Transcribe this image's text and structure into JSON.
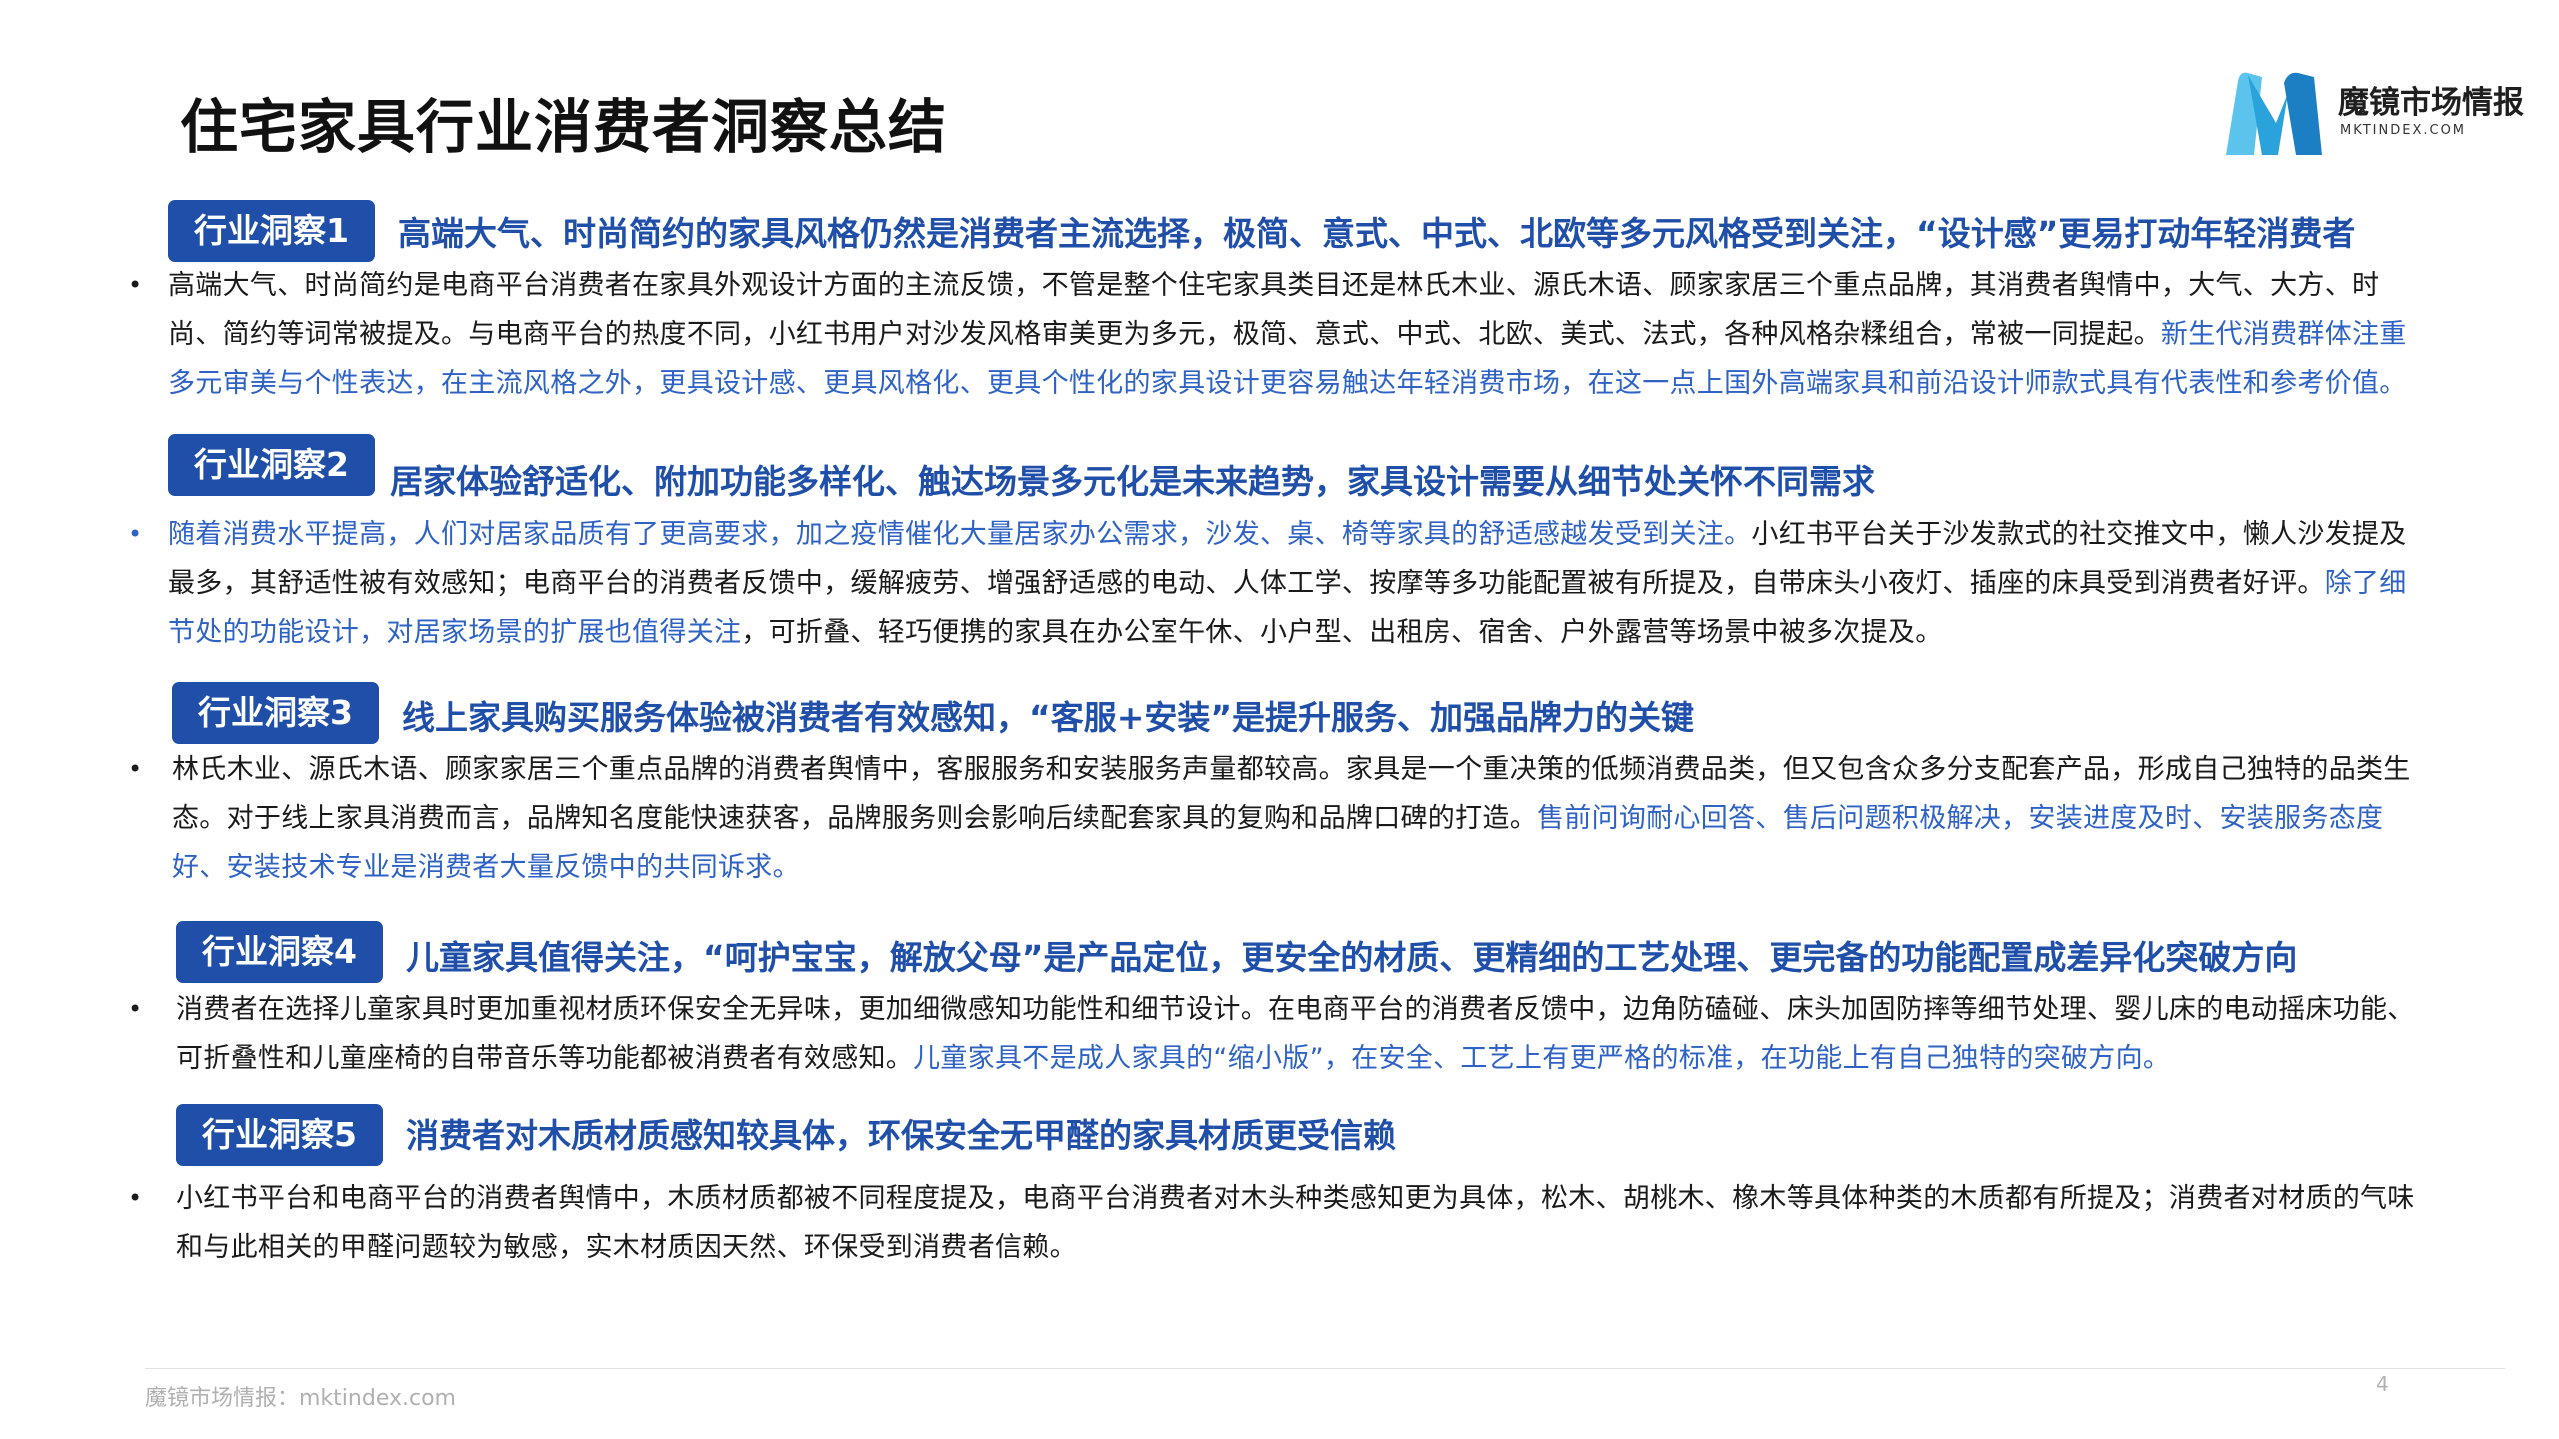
{
  "title": "住宅家具行业消费者洞察总结",
  "logo": {
    "name": "魔镜市场情报",
    "url": "MKTINDEX.COM",
    "icon": "mktindex-m-logo",
    "colors": {
      "light": "#5cc4ec",
      "dark": "#1c7fc4"
    }
  },
  "colors": {
    "badge": "#1f4fa8",
    "headline": "#1f4fa8",
    "highlight": "#2e62c4"
  },
  "insights": [
    {
      "badge": "行业洞察1",
      "headline": "高端大气、时尚简约的家具风格仍然是消费者主流选择，极简、意式、中式、北欧等多元风格受到关注，“设计感”更易打动年轻消费者",
      "text": "高端大气、时尚简约是电商平台消费者在家具外观设计方面的主流反馈，不管是整个住宅家具类目还是林氏木业、源氏木语、顾家家居三个重点品牌，其消费者舆情中，大气、大方、时尚、简约等词常被提及。与电商平台的热度不同，小红书用户对沙发风格审美更为多元，极简、意式、中式、北欧、美式、法式，各种风格杂糅组合，常被一同提起。",
      "highlight": "新生代消费群体注重多元审美与个性表达，在主流风格之外，更具设计感、更具风格化、更具个性化的家具设计更容易触达年轻消费市场，在这一点上国外高端家具和前沿设计师款式具有代表性和参考价值。",
      "tail": ""
    },
    {
      "badge": "行业洞察2",
      "headline": "居家体验舒适化、附加功能多样化、触达场景多元化是未来趋势，家具设计需要从细节处关怀不同需求",
      "text": "",
      "highlight": "随着消费水平提高，人们对居家品质有了更高要求，加之疫情催化大量居家办公需求，沙发、桌、椅等家具的舒适感越发受到关注。",
      "tail": "小红书平台关于沙发款式的社交推文中，懒人沙发提及最多，其舒适性被有效感知；电商平台的消费者反馈中，缓解疲劳、增强舒适感的电动、人体工学、按摩等多功能配置被有所提及，自带床头小夜灯、插座的床具受到消费者好评。",
      "highlight2": "除了细节处的功能设计，对居家场景的扩展也值得关注",
      "tail2": "，可折叠、轻巧便携的家具在办公室午休、小户型、出租房、宿舍、户外露营等场景中被多次提及。"
    },
    {
      "badge": "行业洞察3",
      "headline": "线上家具购买服务体验被消费者有效感知，“客服+安装”是提升服务、加强品牌力的关键",
      "text": "林氏木业、源氏木语、顾家家居三个重点品牌的消费者舆情中，客服服务和安装服务声量都较高。家具是一个重决策的低频消费品类，但又包含众多分支配套产品，形成自己独特的品类生态。对于线上家具消费而言，品牌知名度能快速获客，品牌服务则会影响后续配套家具的复购和品牌口碑的打造。",
      "highlight": "售前问询耐心回答、售后问题积极解决，安装进度及时、安装服务态度好、安装技术专业是消费者大量反馈中的共同诉求。",
      "tail": ""
    },
    {
      "badge": "行业洞察4",
      "headline": "儿童家具值得关注，“呵护宝宝，解放父母”是产品定位，更安全的材质、更精细的工艺处理、更完备的功能配置成差异化突破方向",
      "text": "消费者在选择儿童家具时更加重视材质环保安全无异味，更加细微感知功能性和细节设计。在电商平台的消费者反馈中，边角防磕碰、床头加固防摔等细节处理、婴儿床的电动摇床功能、可折叠性和儿童座椅的自带音乐等功能都被消费者有效感知。",
      "highlight": "儿童家具不是成人家具的“缩小版”，在安全、工艺上有更严格的标准，在功能上有自己独特的突破方向。",
      "tail": ""
    },
    {
      "badge": "行业洞察5",
      "headline": "消费者对木质材质感知较具体，环保安全无甲醛的家具材质更受信赖",
      "text": "小红书平台和电商平台的消费者舆情中，木质材质都被不同程度提及，电商平台消费者对木头种类感知更为具体，松木、胡桃木、橡木等具体种类的木质都有所提及；消费者对材质的气味和与此相关的甲醛问题较为敏感，实木材质因天然、环保受到消费者信赖。",
      "highlight": "",
      "tail": ""
    }
  ],
  "bullet_symbol": "•",
  "footer": {
    "source": "魔镜市场情报：mktindex.com",
    "page": "4"
  }
}
